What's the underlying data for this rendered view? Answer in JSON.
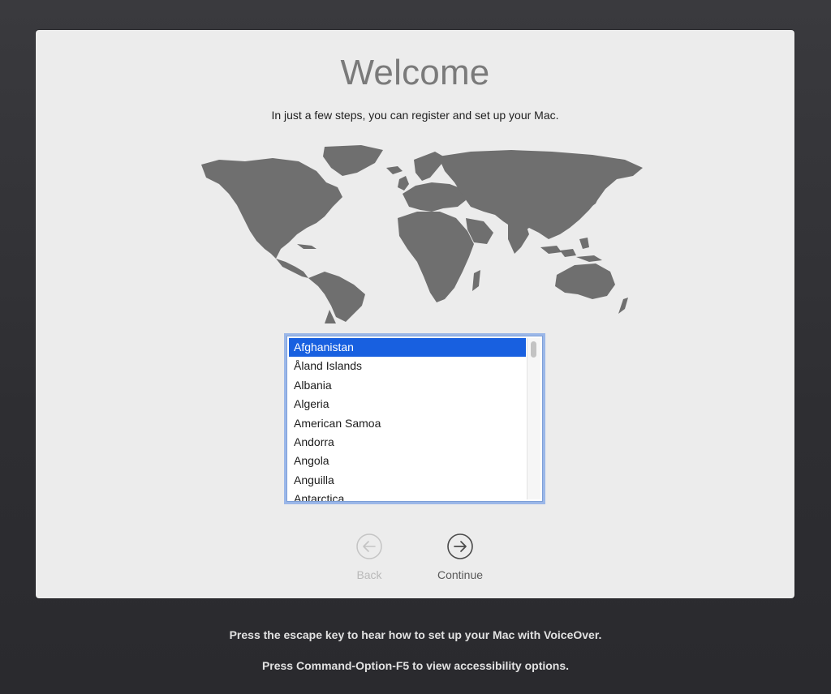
{
  "window": {
    "title": "Welcome",
    "subtitle": "In just a few steps, you can register and set up your Mac."
  },
  "country_list": {
    "selected_index": 0,
    "items": [
      "Afghanistan",
      "Åland Islands",
      "Albania",
      "Algeria",
      "American Samoa",
      "Andorra",
      "Angola",
      "Anguilla",
      "Antarctica"
    ]
  },
  "navigation": {
    "back_label": "Back",
    "back_enabled": false,
    "continue_label": "Continue",
    "continue_enabled": true
  },
  "footer": {
    "voiceover_hint": "Press the escape key to hear how to set up your Mac with VoiceOver.",
    "accessibility_hint": "Press Command-Option-F5 to view accessibility options."
  },
  "icons": {
    "map": "world-map-icon",
    "back": "arrow-left-circle-icon",
    "continue": "arrow-right-circle-icon"
  },
  "colors": {
    "selection": "#1860e0",
    "panel_background": "#ececec",
    "desktop_background": "#2f2f33",
    "map_land": "#6f6f6f"
  }
}
